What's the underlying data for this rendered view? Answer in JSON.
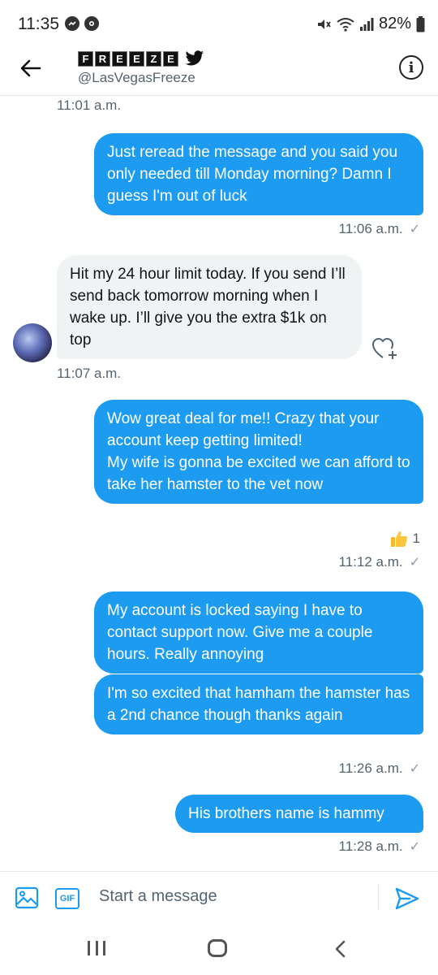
{
  "status_bar": {
    "time": "11:35",
    "battery": "82%"
  },
  "header": {
    "brand_letters": [
      "F",
      "R",
      "E",
      "E",
      "Z",
      "E"
    ],
    "handle": "@LasVegasFreeze",
    "info_label": "i"
  },
  "messages": {
    "ts_top": "11:01 a.m.",
    "m1": "Just reread the message and you said you only needed till Monday morning? Damn I guess I'm out of luck",
    "m1_ts": "11:06 a.m.",
    "m2": "Hit my 24 hour limit today. If you send I’ll send back tomorrow morning when I wake up. I’ll give you the extra $1k on top",
    "m2_ts": "11:07 a.m.",
    "m3": "Wow great deal for me!! Crazy that your account keep getting limited!\nMy wife is gonna be excited we can afford to take her hamster to the vet now",
    "m3_reaction_count": "1",
    "m3_ts": "11:12 a.m.",
    "m4": "My account is locked saying I have to contact support now. Give me a couple hours. Really annoying",
    "m5": "I'm so excited that hamham the hamster has a 2nd chance though thanks again",
    "m5_ts": "11:26 a.m.",
    "m6": "His brothers name is hammy",
    "m6_ts": "11:28 a.m.",
    "check": "✓"
  },
  "composer": {
    "gif_label": "GIF",
    "placeholder": "Start a message"
  },
  "colors": {
    "accent": "#1d9bf0",
    "incoming_bg": "#eff3f4"
  }
}
